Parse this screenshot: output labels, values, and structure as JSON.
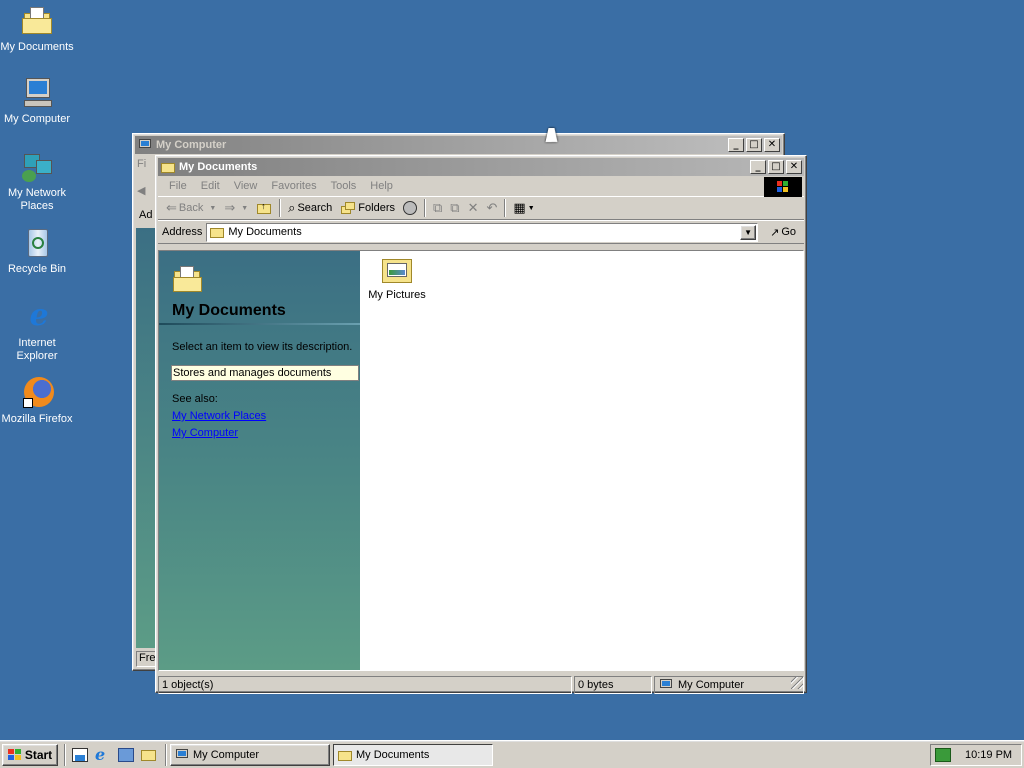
{
  "desktop": {
    "icons": [
      {
        "label": "My Documents"
      },
      {
        "label": "My Computer"
      },
      {
        "label": "My Network Places"
      },
      {
        "label": "Recycle Bin"
      },
      {
        "label": "Internet Explorer"
      },
      {
        "label": "Mozilla Firefox"
      }
    ]
  },
  "back_window": {
    "title": "My Computer",
    "menu_peek": "Fi",
    "address_peek": "Ad",
    "status_peek": "Fre"
  },
  "front_window": {
    "title": "My Documents",
    "menu": [
      "File",
      "Edit",
      "View",
      "Favorites",
      "Tools",
      "Help"
    ],
    "toolbar": {
      "back": "Back",
      "search": "Search",
      "folders": "Folders"
    },
    "address": {
      "label": "Address",
      "value": "My Documents",
      "go": "Go"
    },
    "sidebar": {
      "heading": "My Documents",
      "prompt": "Select an item to view its description.",
      "description": "Stores and manages documents",
      "see_also": "See also:",
      "links": [
        "My Network Places",
        "My Computer"
      ]
    },
    "files": [
      {
        "name": "My Pictures"
      }
    ],
    "status": {
      "objects": "1 object(s)",
      "size": "0 bytes",
      "zone": "My Computer"
    }
  },
  "taskbar": {
    "start": "Start",
    "tasks": [
      {
        "label": "My Computer"
      },
      {
        "label": "My Documents"
      }
    ],
    "clock": "10:19 PM"
  },
  "colors": {
    "desktop": "#3a6ea5",
    "sidebar_top": "#3b6f84",
    "sidebar_bottom": "#5c9c86",
    "link": "#0000ff"
  }
}
